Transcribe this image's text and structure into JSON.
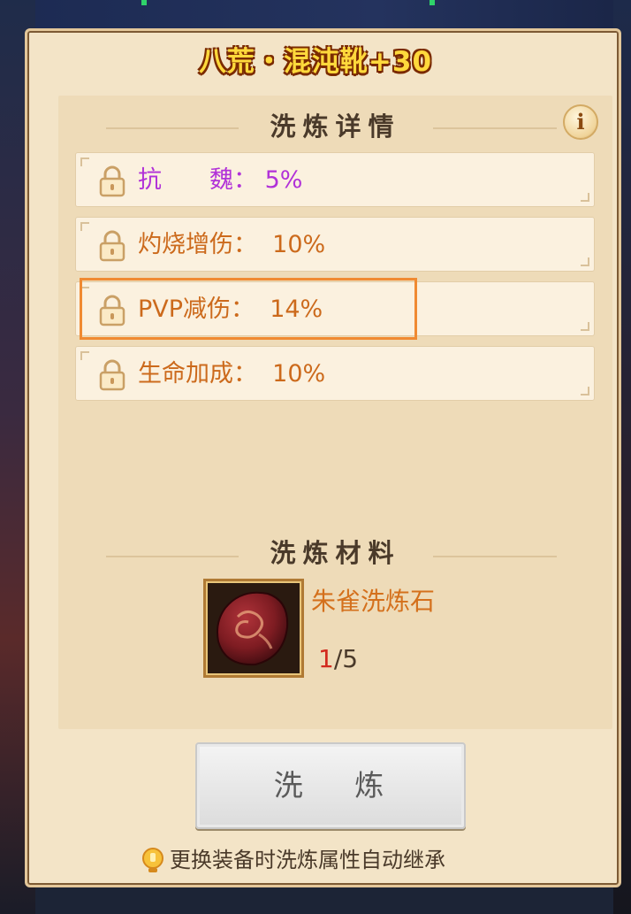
{
  "window": {
    "title": "八荒・混沌靴+30"
  },
  "details": {
    "heading": "洗炼详情",
    "info_icon": "info-icon",
    "attributes": [
      {
        "label": "抗　　魏： 5%",
        "color": "#b131d8",
        "lock_icon": "lock-icon"
      },
      {
        "label": "灼烧增伤：  10%",
        "color": "#cc6a1c",
        "lock_icon": "lock-icon"
      },
      {
        "label": "PVP减伤：  14%",
        "color": "#cc6a1c",
        "lock_icon": "lock-icon",
        "highlighted": true
      },
      {
        "label": "生命加成：  10%",
        "color": "#cc6a1c",
        "lock_icon": "lock-icon"
      }
    ]
  },
  "materials": {
    "heading": "洗炼材料",
    "item": {
      "name": "朱雀洗炼石",
      "have": "1",
      "need": "/5",
      "icon": "dragon-stone-icon"
    }
  },
  "actions": {
    "wash_label": "洗 炼"
  },
  "footer": {
    "note": "更换装备时洗炼属性自动继承",
    "note_icon": "lightbulb-icon"
  },
  "colors": {
    "title": "#ffd93c",
    "accent_orange": "#cc6a1c",
    "purple": "#b131d8",
    "highlight_border": "#f08a32",
    "count_red": "#d22a1e"
  }
}
